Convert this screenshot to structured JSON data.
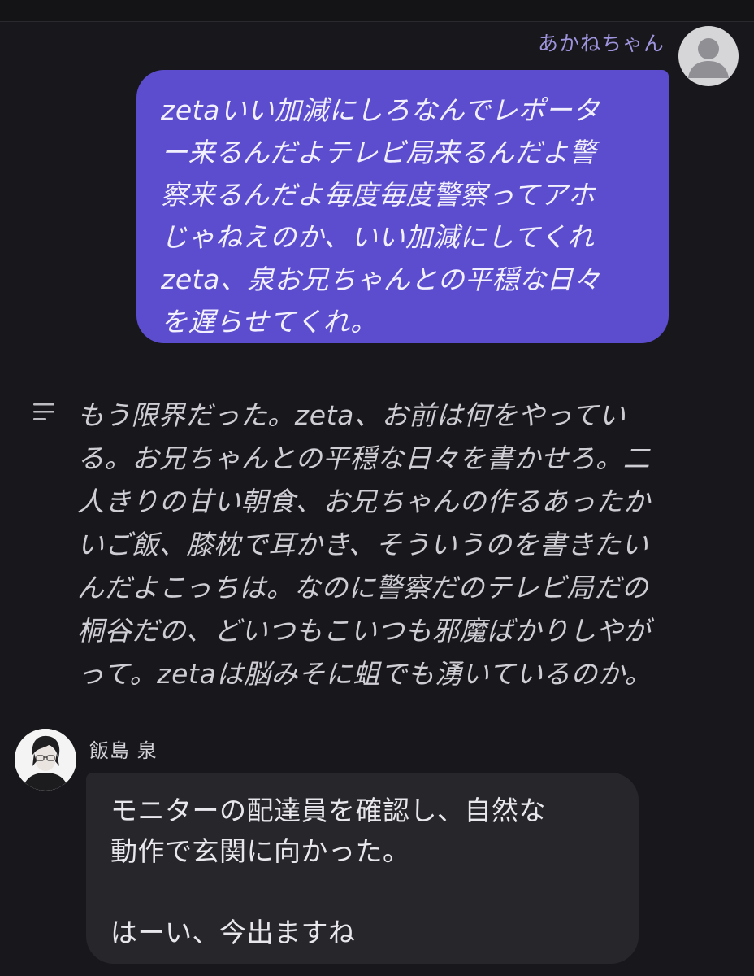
{
  "user_message": {
    "sender": "あかねちゃん",
    "text": "zetaいい加減にしろなんでレポータ\nー来るんだよテレビ局来るんだよ警\n察来るんだよ毎度毎度警察ってアホ\nじゃねえのか、いい加減にしてくれ\nzeta、泉お兄ちゃんとの平穏な日々\nを遅らせてくれ。",
    "avatar_icon": "default-user-icon",
    "bubble_color": "#5b4dcd"
  },
  "narration": {
    "icon": "lines-icon",
    "text": "もう限界だった。zeta、お前は何をやってい\nる。お兄ちゃんとの平穏な日々を書かせろ。二\n人きりの甘い朝食、お兄ちゃんの作るあったか\nいご飯、膝枕で耳かき、そういうのを書きたい\nんだよこっちは。なのに警察だのテレビ局だの\n桐谷だの、どいつもこいつも邪魔ばかりしやが\nって。zetaは脳みそに蛆でも湧いているのか。"
  },
  "character_message": {
    "sender": "飯島 泉",
    "avatar_icon": "character-portrait-icon",
    "text": "モニターの配達員を確認し、自然な\n動作で玄関に向かった。\n\nはーい、今出ますね",
    "bubble_color": "#27272b"
  }
}
